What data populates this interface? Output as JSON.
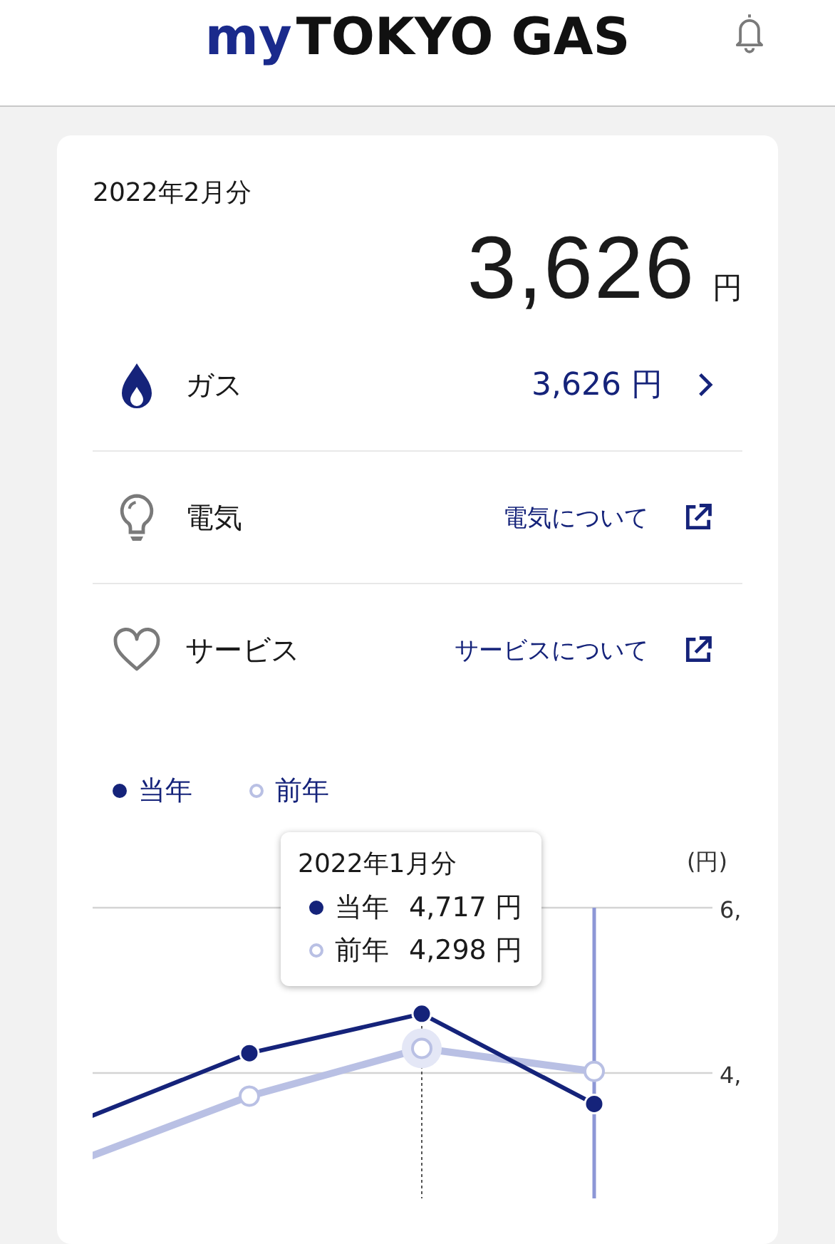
{
  "header": {
    "logo_prefix": "my",
    "logo_name": "TOKYO GAS"
  },
  "bill": {
    "period": "2022年2月分",
    "amount": "3,626",
    "unit": "円"
  },
  "services": [
    {
      "kind": "amount",
      "label": "ガス",
      "value": "3,626 円"
    },
    {
      "kind": "link",
      "label": "電気",
      "value": "電気について"
    },
    {
      "kind": "link",
      "label": "サービス",
      "value": "サービスについて"
    }
  ],
  "chart": {
    "unit": "(円)",
    "y_labels": [
      "6,",
      "4,"
    ],
    "series": [
      {
        "name": "当年",
        "color": "#15237a"
      },
      {
        "name": "前年",
        "color": "#b9c0e4"
      }
    ],
    "tooltip": {
      "title": "2022年1月分",
      "rows": [
        {
          "label": "当年",
          "value": "4,717 円"
        },
        {
          "label": "前年",
          "value": "4,298 円"
        }
      ]
    }
  }
}
